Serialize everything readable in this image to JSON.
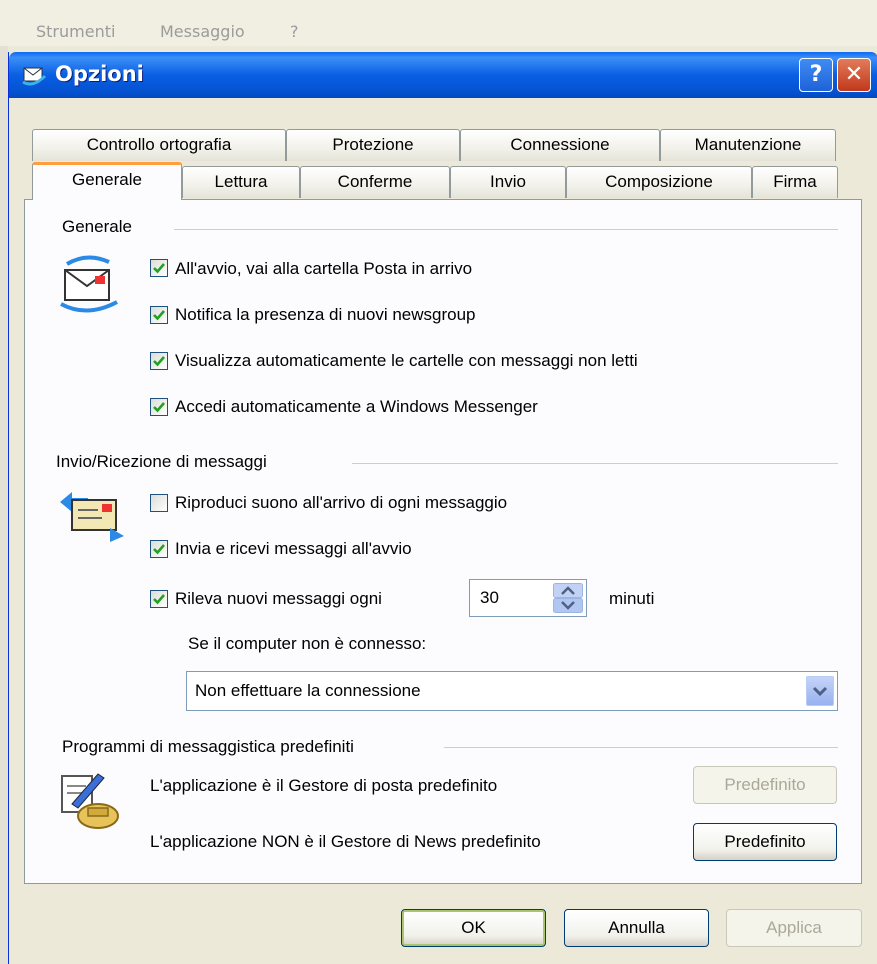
{
  "menu": {
    "items": [
      "Strumenti",
      "Messaggio",
      "?"
    ]
  },
  "dialog": {
    "title": "Opzioni",
    "help_glyph": "?",
    "close_glyph": "✕"
  },
  "tabs": {
    "row_top": [
      "Controllo ortografia",
      "Protezione",
      "Connessione",
      "Manutenzione"
    ],
    "row_bottom": [
      "Generale",
      "Lettura",
      "Conferme",
      "Invio",
      "Composizione",
      "Firma"
    ],
    "active": "Generale"
  },
  "general": {
    "title": "Generale",
    "options": [
      {
        "label": "All'avvio, vai alla cartella Posta in arrivo",
        "checked": true
      },
      {
        "label": "Notifica la presenza di nuovi newsgroup",
        "checked": true
      },
      {
        "label": "Visualizza automaticamente le cartelle con messaggi non letti",
        "checked": true
      },
      {
        "label": "Accedi automaticamente a Windows Messenger",
        "checked": true
      }
    ]
  },
  "send_receive": {
    "title": "Invio/Ricezione di messaggi",
    "options": [
      {
        "label": "Riproduci suono all'arrivo di ogni messaggio",
        "checked": false
      },
      {
        "label": "Invia e ricevi messaggi all'avvio",
        "checked": true
      },
      {
        "label": "Rileva nuovi messaggi ogni",
        "checked": true
      }
    ],
    "interval_value": "30",
    "interval_unit": "minuti",
    "not_connected_label": "Se il computer non è connesso:",
    "not_connected_value": "Non effettuare la connessione"
  },
  "default_programs": {
    "title": "Programmi di messaggistica predefiniti",
    "mail_text": "L'applicazione è il Gestore di posta predefinito",
    "mail_button": "Predefinito",
    "news_text": "L'applicazione NON è il Gestore di News predefinito",
    "news_button": "Predefinito"
  },
  "footer": {
    "ok": "OK",
    "cancel": "Annulla",
    "apply": "Applica"
  },
  "colors": {
    "title_bar": "#0a5fe4",
    "active_tab_accent": "#ff9e3d",
    "check": "#21a121",
    "face": "#ece9d8"
  }
}
